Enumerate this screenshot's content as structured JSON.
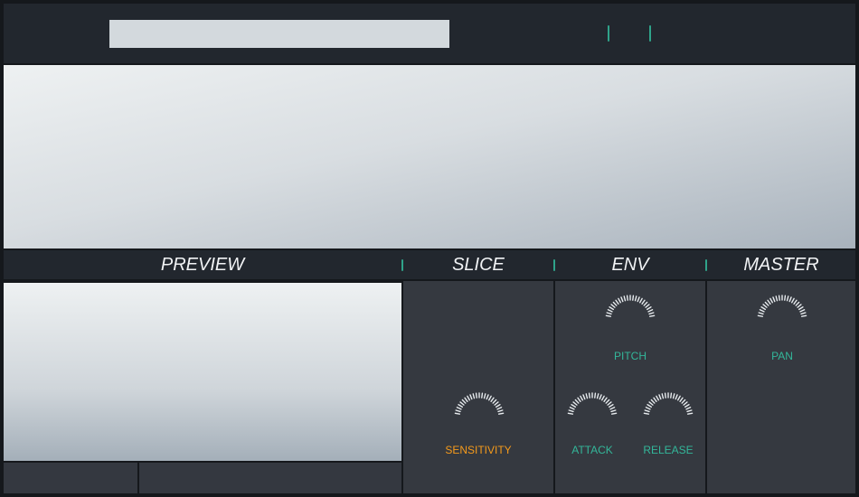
{
  "header": {
    "title_value": "",
    "sections": {
      "preview": "PREVIEW",
      "slice": "SLICE",
      "env": "ENV",
      "master": "MASTER"
    }
  },
  "knobs": {
    "sensitivity": "SENSITIVITY",
    "pitch": "PITCH",
    "attack": "ATTACK",
    "release": "RELEASE",
    "pan": "PAN"
  },
  "colors": {
    "accent_teal": "#33b79a",
    "accent_orange": "#f59a1b",
    "panel": "#353940",
    "bar": "#22272e"
  },
  "icons": [
    "knob-icon"
  ]
}
